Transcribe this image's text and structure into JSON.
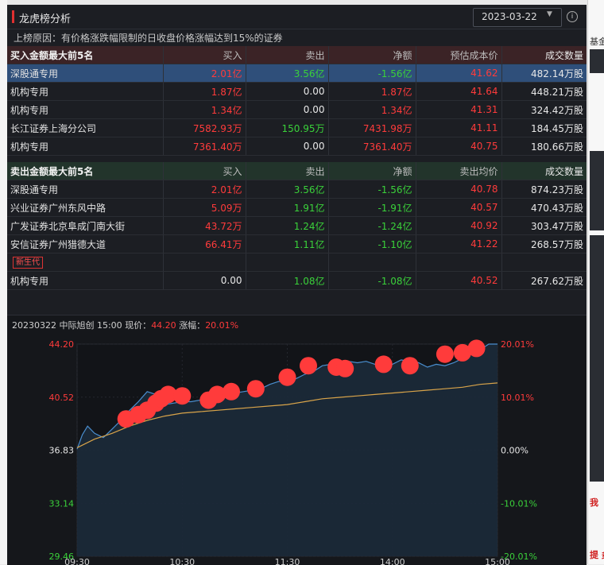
{
  "window": {
    "title": "龙虎榜分析",
    "date": "2023-03-22",
    "reason": "上榜原因：有价格涨跌幅限制的日收盘价格涨幅达到15%的证券"
  },
  "buy_table": {
    "header": [
      "买入金额最大前5名",
      "买入",
      "卖出",
      "净额",
      "预估成本价",
      "成交数量"
    ],
    "rows": [
      {
        "name": "深股通专用",
        "buy": "2.01亿",
        "sell": "3.56亿",
        "net": "-1.56亿",
        "price": "41.62",
        "volume": "482.14万股",
        "highlight": true
      },
      {
        "name": "机构专用",
        "buy": "1.87亿",
        "sell": "0.00",
        "net": "1.87亿",
        "price": "41.64",
        "volume": "448.21万股"
      },
      {
        "name": "机构专用",
        "buy": "1.34亿",
        "sell": "0.00",
        "net": "1.34亿",
        "price": "41.31",
        "volume": "324.42万股"
      },
      {
        "name": "长江证券上海分公司",
        "buy": "7582.93万",
        "sell": "150.95万",
        "net": "7431.98万",
        "price": "41.11",
        "volume": "184.45万股"
      },
      {
        "name": "机构专用",
        "buy": "7361.40万",
        "sell": "0.00",
        "net": "7361.40万",
        "price": "40.75",
        "volume": "180.66万股"
      }
    ]
  },
  "sell_table": {
    "header": [
      "卖出金额最大前5名",
      "买入",
      "卖出",
      "净额",
      "卖出均价",
      "成交数量"
    ],
    "rows": [
      {
        "name": "深股通专用",
        "buy": "2.01亿",
        "sell": "3.56亿",
        "net": "-1.56亿",
        "price": "40.78",
        "volume": "874.23万股"
      },
      {
        "name": "兴业证券广州东风中路",
        "buy": "5.09万",
        "sell": "1.91亿",
        "net": "-1.91亿",
        "price": "40.57",
        "volume": "470.43万股"
      },
      {
        "name": "广发证券北京阜成门南大街",
        "buy": "43.72万",
        "sell": "1.24亿",
        "net": "-1.24亿",
        "price": "40.92",
        "volume": "303.47万股"
      },
      {
        "name": "安信证券广州猎德大道",
        "badge": "新生代",
        "buy": "66.41万",
        "sell": "1.11亿",
        "net": "-1.10亿",
        "price": "41.22",
        "volume": "268.57万股"
      },
      {
        "name": "机构专用",
        "buy": "0.00",
        "sell": "1.08亿",
        "net": "-1.08亿",
        "price": "40.52",
        "volume": "267.62万股"
      }
    ]
  },
  "chart_head": {
    "date_name": "20230322 中际旭创 15:00",
    "price_label": "现价：",
    "price": "44.20",
    "change_label": "涨幅：",
    "change": "20.01%"
  },
  "chart_data": {
    "type": "line",
    "title": "",
    "ylim": [
      29.46,
      44.2
    ],
    "y_ticks_left": [
      "44.20",
      "40.52",
      "36.83",
      "33.14",
      "29.46"
    ],
    "y_ticks_right": [
      "20.01%",
      "10.01%",
      "0.00%",
      "-10.01%",
      "-20.01%"
    ],
    "x_ticks": [
      "09:30",
      "10:30",
      "11:30",
      "14:00",
      "15:00"
    ],
    "series": [
      {
        "x": [
          0,
          3,
          6,
          10,
          15,
          20,
          25,
          30,
          35,
          40,
          45,
          50,
          55,
          60,
          65,
          70,
          75,
          80,
          85,
          90,
          95,
          100,
          105,
          110,
          115,
          120,
          125,
          130,
          135,
          140,
          145,
          150,
          155,
          160,
          165,
          170,
          175,
          180,
          185,
          190,
          195,
          200,
          205,
          210,
          215,
          220,
          225,
          230,
          235,
          240
        ],
        "values": [
          36.9,
          37.9,
          38.5,
          38.0,
          37.7,
          38.3,
          38.9,
          39.6,
          40.2,
          40.9,
          40.7,
          40.0,
          40.1,
          40.2,
          40.2,
          40.3,
          40.6,
          41.0,
          41.1,
          40.8,
          40.9,
          41.0,
          41.1,
          41.4,
          41.6,
          41.7,
          41.8,
          42.1,
          42.3,
          42.7,
          42.8,
          42.6,
          43.0,
          42.9,
          43.0,
          42.8,
          42.7,
          42.8,
          43.1,
          43.0,
          42.9,
          42.6,
          42.8,
          42.7,
          42.9,
          43.2,
          43.5,
          43.8,
          44.2,
          44.2
        ]
      },
      {
        "x": [
          0,
          10,
          20,
          30,
          40,
          50,
          60,
          70,
          80,
          90,
          100,
          110,
          120,
          130,
          140,
          150,
          160,
          170,
          180,
          190,
          200,
          210,
          220,
          230,
          240
        ],
        "values": [
          37.0,
          37.6,
          38.0,
          38.5,
          38.9,
          39.2,
          39.4,
          39.5,
          39.6,
          39.7,
          39.8,
          39.9,
          40.0,
          40.2,
          40.4,
          40.5,
          40.6,
          40.7,
          40.8,
          40.9,
          41.0,
          41.1,
          41.2,
          41.4,
          41.5
        ]
      }
    ],
    "markers": {
      "x": [
        28,
        35,
        40,
        45,
        48,
        52,
        60,
        75,
        80,
        88,
        102,
        120,
        132,
        148,
        153,
        175,
        190,
        210,
        220,
        228
      ],
      "values": [
        39.0,
        39.3,
        39.6,
        40.1,
        40.4,
        40.7,
        40.6,
        40.3,
        40.7,
        40.9,
        41.1,
        41.9,
        42.7,
        42.6,
        42.5,
        42.8,
        42.7,
        43.5,
        43.6,
        43.9
      ]
    },
    "colors": {
      "price_line": "#4a8fd0",
      "avg_line": "#d9a44a",
      "area_fill": "#1c2a3a",
      "markers": "#ff3b3b",
      "up_text": "#ff3b3b",
      "down_text": "#3ad13a",
      "zero_text": "#e8e8e8"
    }
  },
  "background": {
    "right_labels": [
      "基金",
      "我",
      "提 炙"
    ]
  }
}
